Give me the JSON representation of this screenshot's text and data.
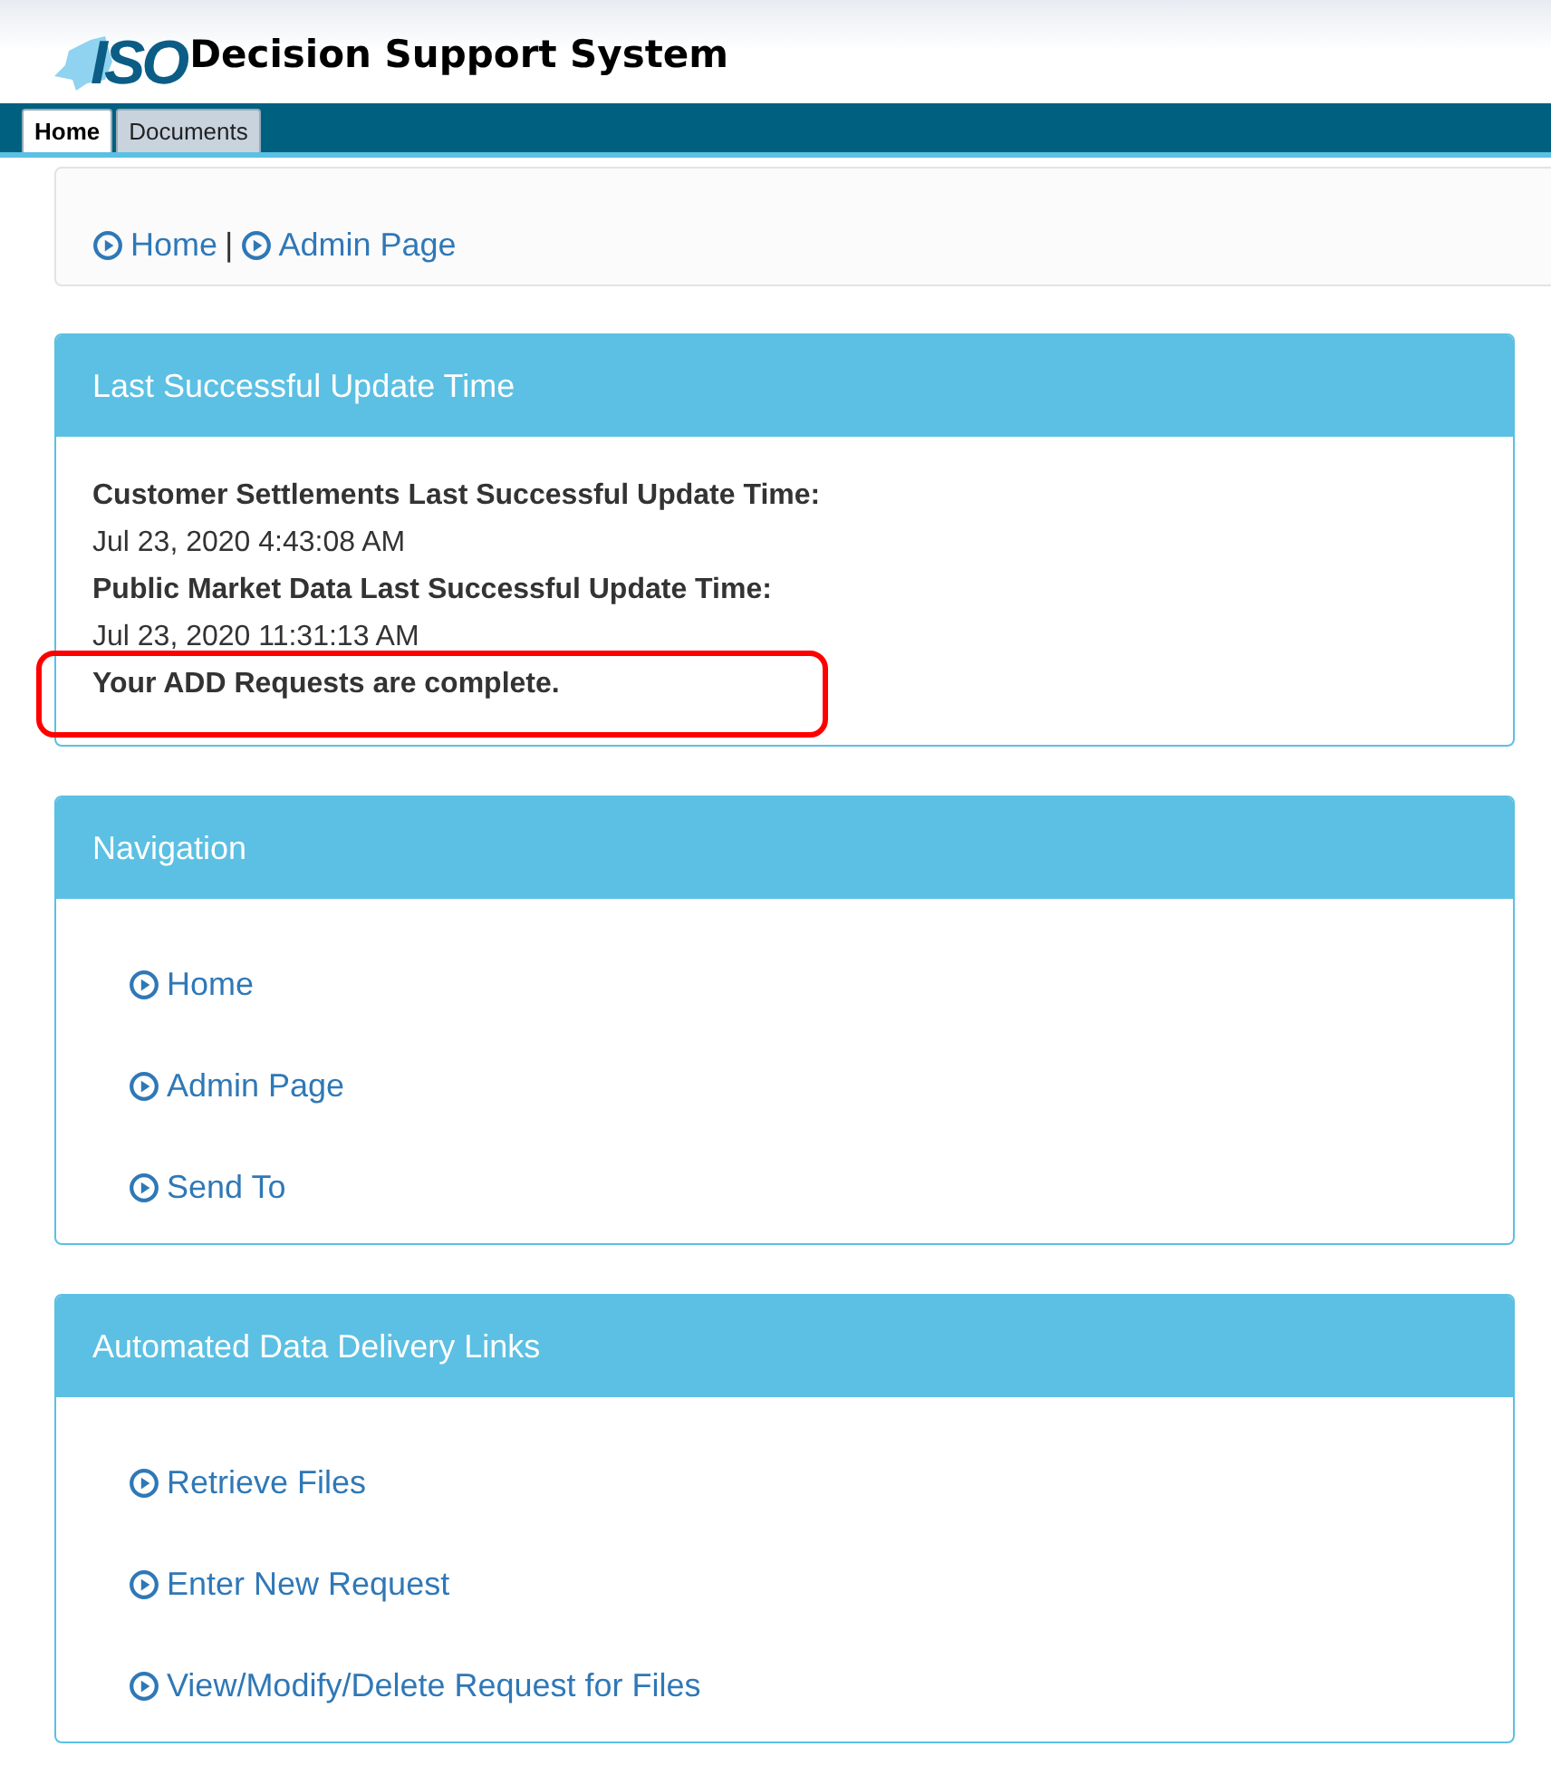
{
  "header": {
    "logo_text": "ISO",
    "title": "Decision Support System"
  },
  "tabs": [
    {
      "label": "Home",
      "selected": true
    },
    {
      "label": "Documents",
      "selected": false
    }
  ],
  "breadcrumb": {
    "items": [
      "Home",
      "Admin Page"
    ],
    "separator": "|"
  },
  "panels": [
    {
      "kind": "status",
      "title": "Last Successful Update Time",
      "lines": [
        {
          "kind": "label",
          "text": "Customer Settlements Last Successful Update Time:"
        },
        {
          "kind": "value",
          "text": "Jul 23, 2020 4:43:08 AM"
        },
        {
          "kind": "label",
          "text": "Public Market Data Last Successful Update Time:"
        },
        {
          "kind": "value",
          "text": "Jul 23, 2020 11:31:13 AM"
        },
        {
          "kind": "label",
          "text": "Your ADD Requests are complete.",
          "highlighted": true
        }
      ]
    },
    {
      "kind": "links",
      "title": "Navigation",
      "links": [
        "Home",
        "Admin Page",
        "Send To"
      ]
    },
    {
      "kind": "links",
      "title": "Automated Data Delivery Links",
      "links": [
        "Retrieve Files",
        "Enter New Request",
        "View/Modify/Delete Request for Files"
      ]
    }
  ]
}
